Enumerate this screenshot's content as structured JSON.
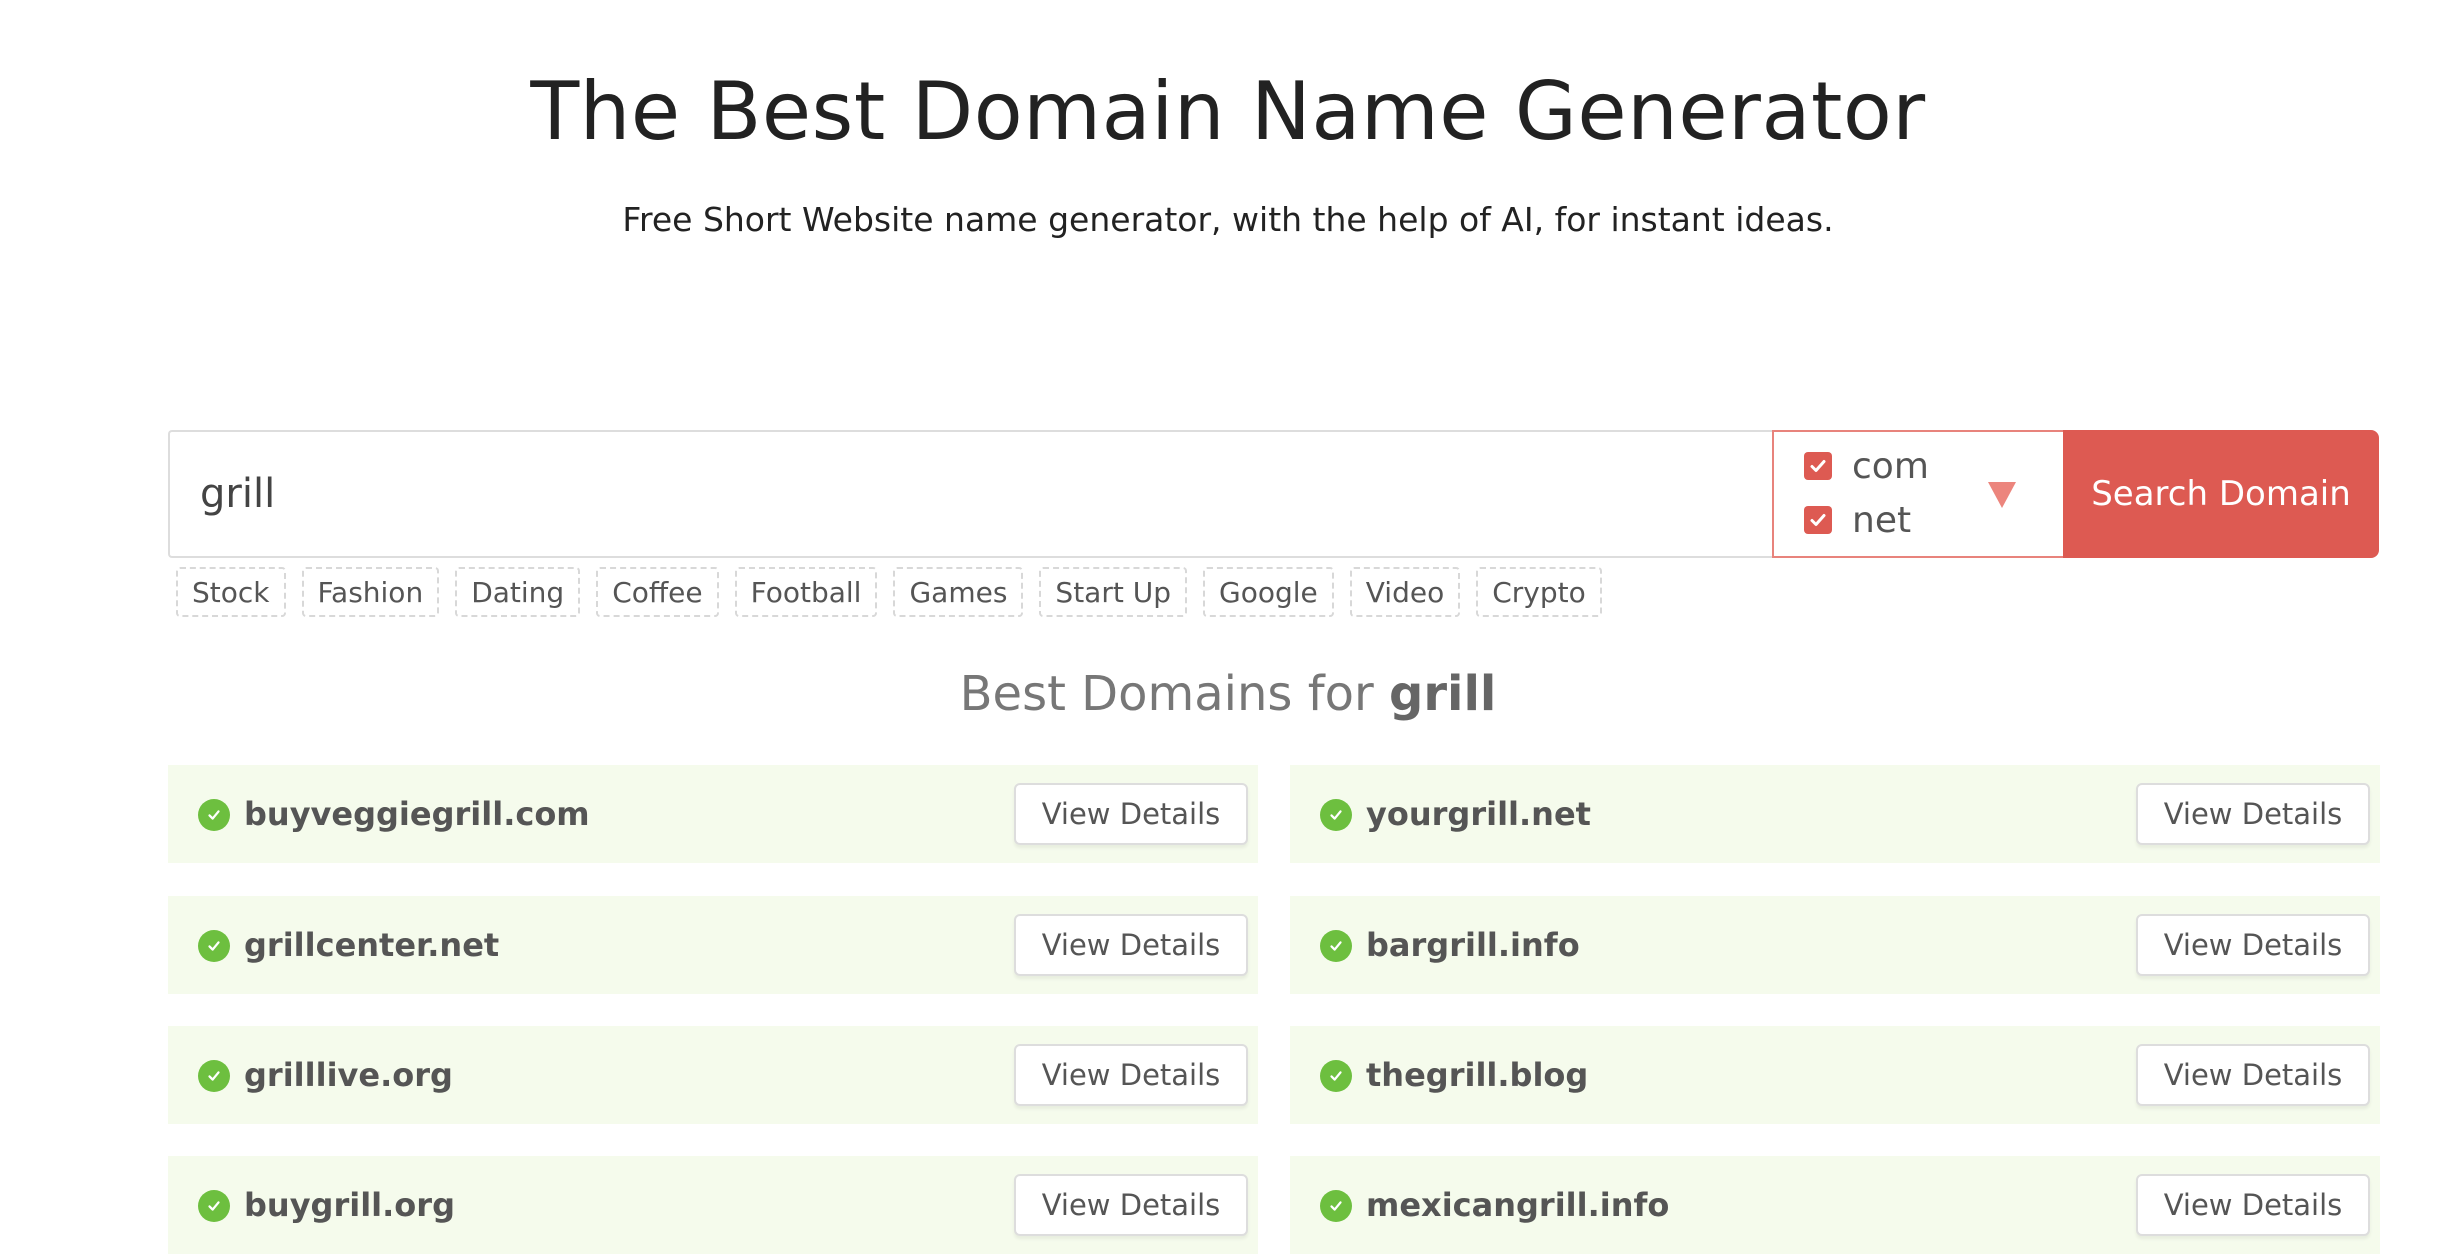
{
  "header": {
    "title": "The Best Domain Name Generator",
    "subtitle": "Free Short Website name generator, with the help of AI, for instant ideas."
  },
  "search": {
    "value": "grill",
    "tlds": [
      {
        "label": "com",
        "checked": true
      },
      {
        "label": "net",
        "checked": true
      }
    ],
    "button_label": "Search Domain"
  },
  "tags": [
    "Stock",
    "Fashion",
    "Dating",
    "Coffee",
    "Football",
    "Games",
    "Start Up",
    "Google",
    "Video",
    "Crypto"
  ],
  "results": {
    "heading_prefix": "Best Domains for",
    "heading_keyword": "grill",
    "view_label": "View Details",
    "items": [
      {
        "domain": "buyveggiegrill.com",
        "status": "available"
      },
      {
        "domain": "yourgrill.net",
        "status": "available"
      },
      {
        "domain": "grillcenter.net",
        "status": "available"
      },
      {
        "domain": "bargrill.info",
        "status": "available"
      },
      {
        "domain": "grilllive.org",
        "status": "available"
      },
      {
        "domain": "thegrill.blog",
        "status": "available"
      },
      {
        "domain": "buygrill.org",
        "status": "available"
      },
      {
        "domain": "mexicangrill.info",
        "status": "available"
      }
    ]
  },
  "colors": {
    "accent": "#dd5a52",
    "row_bg": "#f5fbec",
    "available": "#6dbf3f"
  }
}
